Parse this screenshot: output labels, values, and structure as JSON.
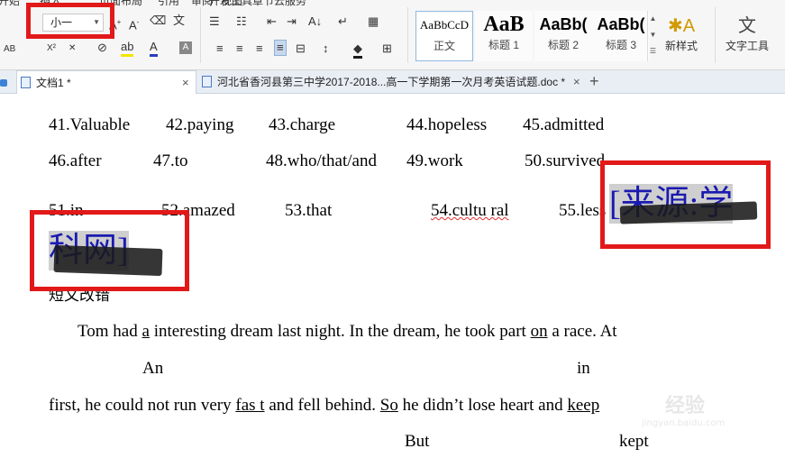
{
  "ribbon": {
    "menu_items": [
      "开始",
      "插入",
      "页面布局",
      "引用",
      "审阅",
      "视图",
      "章节",
      "开发工具",
      "云服务"
    ],
    "font_size": "小一",
    "styles": [
      {
        "preview": "AaBbCcD",
        "name": "正文"
      },
      {
        "preview": "AaB",
        "name": "标题 1"
      },
      {
        "preview": "AaBb(",
        "name": "标题 2"
      },
      {
        "preview": "AaBb(",
        "name": "标题 3"
      }
    ],
    "new_style_label": "新样式",
    "text_tools_label": "文字工具",
    "font_color": "#e00000",
    "highlight_color": "#f5e400",
    "accent": "#2b579a"
  },
  "tabs": [
    {
      "label": "文档1 *",
      "close": "×"
    },
    {
      "label": "河北省香河县第三中学2017-2018...高一下学期第一次月考英语试题.doc *",
      "close": "×"
    }
  ],
  "new_tab": "+",
  "doc": {
    "row1": [
      "41.Valuable",
      "42.paying",
      "43.charge",
      "44.hopeless",
      "45.admitted"
    ],
    "row2": [
      "46.after",
      "47.to",
      "48.who/that/and",
      "49.work",
      "50.survived"
    ],
    "row3": [
      "51.in",
      "52.amazed",
      "53.that",
      "54.cultu ral",
      "55.less"
    ],
    "source_tag_1": "[来源:学",
    "source_tag_2": "科网]",
    "heading": "短文改错",
    "sentence1": {
      "p1": "Tom had ",
      "u1": "a",
      "p2": " interesting dream last night. In the dream, he took part ",
      "u2": "on",
      "p3": " a race. At"
    },
    "corrections1": [
      "An",
      "in"
    ],
    "sentence2": {
      "p1": "first, he could not run very ",
      "u1": "fas t",
      "p2": " and fell behind. ",
      "u2": "So",
      "p3": " he didn’t lose heart and ",
      "u3": "keep"
    },
    "corrections2": [
      "But",
      "kept"
    ]
  },
  "watermark": {
    "text": "经验",
    "url": "jingyan.baidu.com"
  }
}
